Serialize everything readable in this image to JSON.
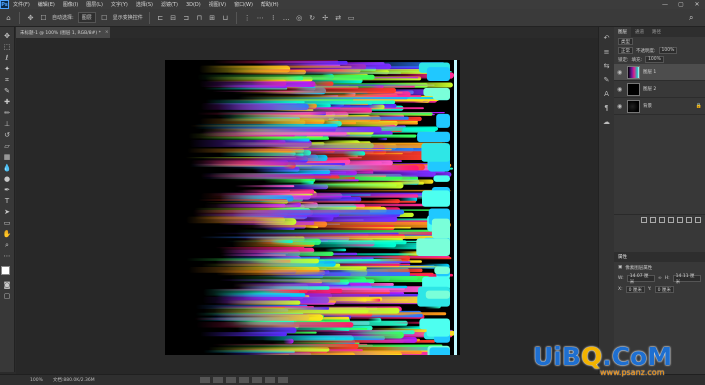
{
  "app": {
    "logo_text": "Ps",
    "menu": [
      "文件(F)",
      "编辑(E)",
      "图像(I)",
      "图层(L)",
      "文字(Y)",
      "选择(S)",
      "滤镜(T)",
      "3D(D)",
      "视图(V)",
      "窗口(W)",
      "帮助(H)"
    ],
    "window_controls": [
      "—",
      "▢",
      "✕"
    ]
  },
  "options_bar": {
    "auto_select_label": "自动选择:",
    "auto_select_target": "图层",
    "show_transform_label": "显示变换控件"
  },
  "document": {
    "tab_title": "未标题-1 @ 100% (图层 1, RGB/8#) *",
    "tab_close": "×",
    "zoom": "100%",
    "doc_size": "文档:880.0K/2.36M"
  },
  "layers_panel": {
    "tabs": [
      "图层",
      "通道",
      "路径"
    ],
    "kind_filter": "类型",
    "blend_mode": "正常",
    "opacity_label": "不透明度:",
    "opacity_value": "100%",
    "lock_label": "锁定:",
    "fill_label": "填充:",
    "fill_value": "100%",
    "layers": [
      {
        "name": "图层 1",
        "selected": true
      },
      {
        "name": "图层 2",
        "selected": false
      },
      {
        "name": "背景",
        "selected": false,
        "locked": true
      }
    ]
  },
  "properties_panel": {
    "title": "属性",
    "subtitle": "像素图层属性",
    "w_label": "W:",
    "w_value": "14.07 厘米",
    "h_label": "H:",
    "h_value": "14.11 厘米",
    "x_label": "X:",
    "x_value": "0 厘米",
    "y_label": "Y:",
    "y_value": "0 厘米"
  },
  "watermark": {
    "text_a": "UiB",
    "text_b": "Q",
    "text_c": ".CoM",
    "url": "www.psanz.com"
  },
  "colors": {
    "accent": "#4da3ff",
    "canvas_bg": "#000000",
    "workspace": "#282828"
  }
}
